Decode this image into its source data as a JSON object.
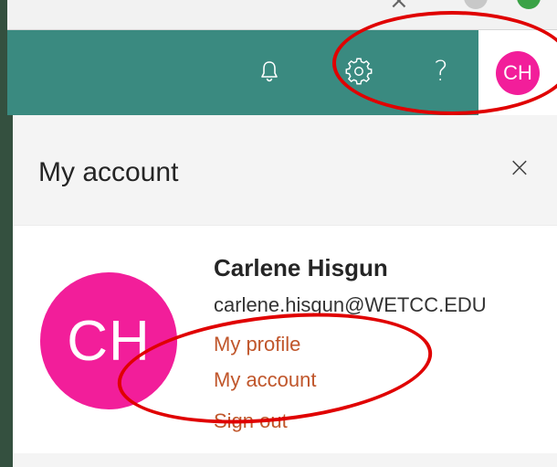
{
  "header": {
    "bell_icon": "bell-icon",
    "gear_icon": "gear-icon",
    "help_glyph": "?",
    "me_initials": "CH",
    "accent_color": "#3a8a80",
    "avatar_color": "#f21e9a"
  },
  "panel": {
    "title": "My account",
    "close_glyph": "×",
    "user": {
      "initials": "CH",
      "name": "Carlene Hisgun",
      "email": "carlene.hisgun@WETCC.EDU"
    },
    "links": {
      "profile": "My profile",
      "account": "My account",
      "signout": "Sign out"
    },
    "link_color": "#c0562b"
  },
  "annotation_color": "#e00000"
}
